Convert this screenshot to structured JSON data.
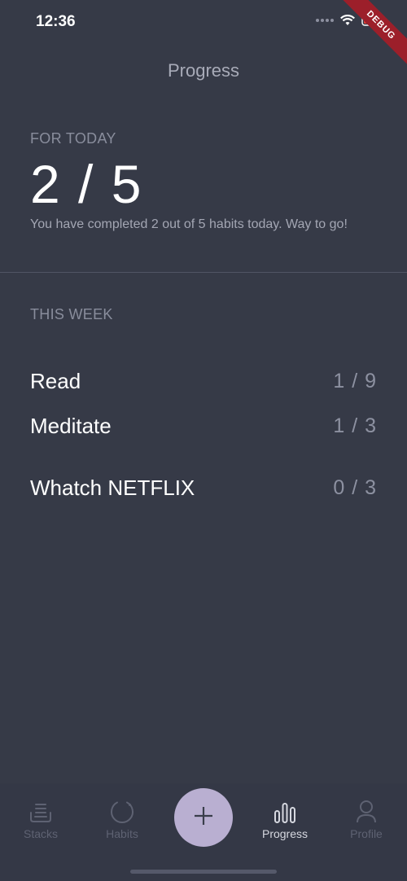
{
  "status_bar": {
    "time": "12:36"
  },
  "debug_banner": "DEBUG",
  "header": {
    "title": "Progress"
  },
  "today": {
    "label": "FOR TODAY",
    "count": "2 / 5",
    "message": "You have completed 2 out of 5 habits today. Way to go!"
  },
  "week": {
    "label": "THIS WEEK",
    "habits": [
      {
        "name": "Read",
        "progress": "1 / 9"
      },
      {
        "name": "Meditate",
        "progress": "1 / 3"
      },
      {
        "name": "Whatch NETFLIX",
        "progress": "0 / 3"
      }
    ]
  },
  "bottom_nav": {
    "items": [
      {
        "label": "Stacks",
        "icon": "stacks-icon"
      },
      {
        "label": "Habits",
        "icon": "habits-icon"
      },
      {
        "label": "Progress",
        "icon": "bar-chart-icon",
        "active": true
      },
      {
        "label": "Profile",
        "icon": "person-icon"
      }
    ],
    "fab_icon": "plus-icon"
  },
  "colors": {
    "background": "#363a47",
    "fab": "#b9afd1",
    "debug": "#9c1f2a",
    "battery_low": "#e0453a"
  }
}
